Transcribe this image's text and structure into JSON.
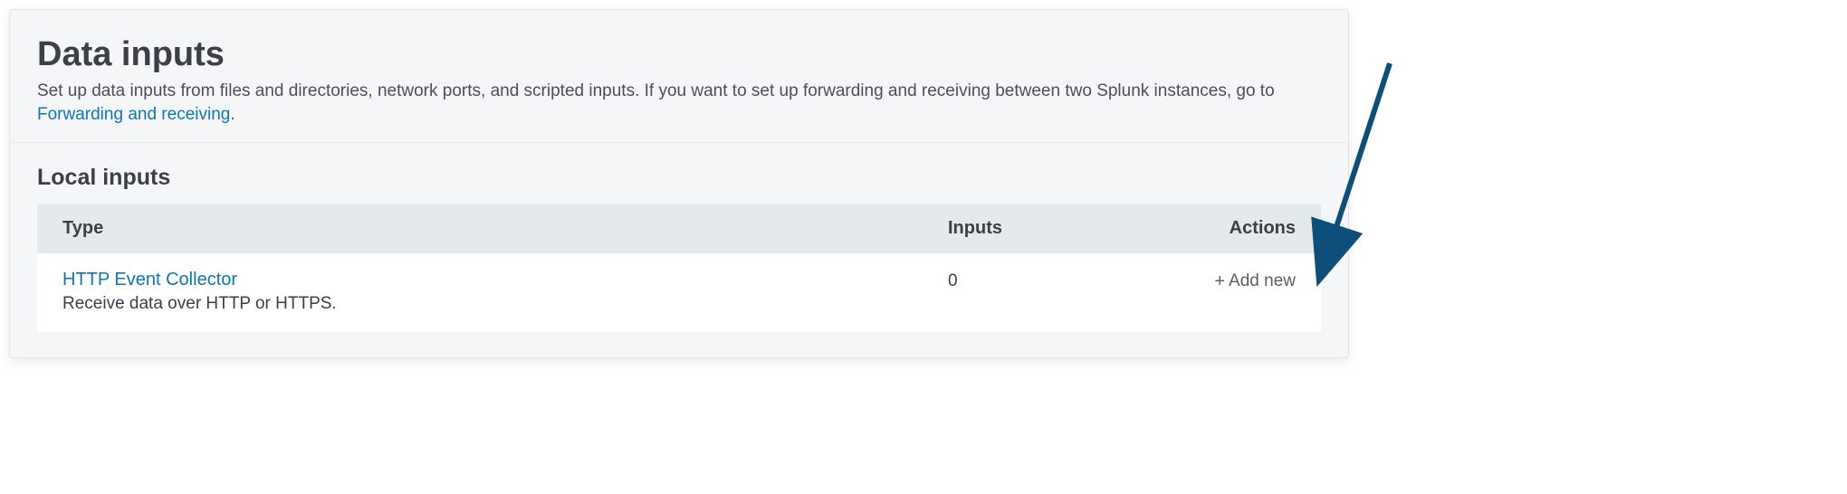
{
  "header": {
    "title": "Data inputs",
    "description_pre": "Set up data inputs from files and directories, network ports, and scripted inputs. If you want to set up forwarding and receiving between two Splunk instances, go to ",
    "link_text": "Forwarding and receiving",
    "description_post": "."
  },
  "section": {
    "title": "Local inputs"
  },
  "table": {
    "columns": {
      "type": "Type",
      "inputs": "Inputs",
      "actions": "Actions"
    },
    "rows": [
      {
        "title": "HTTP Event Collector",
        "description": "Receive data over HTTP or HTTPS.",
        "inputs": "0",
        "action_label": "Add new"
      }
    ]
  },
  "icons": {
    "plus": "+"
  }
}
